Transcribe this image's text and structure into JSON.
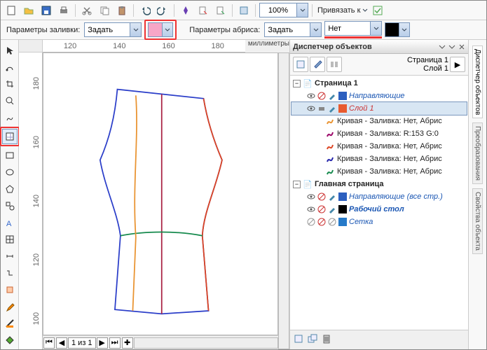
{
  "toolbar_top": {
    "zoom_value": "100%",
    "bind_label": "Привязать к",
    "icons": [
      "new",
      "open",
      "save",
      "print",
      "cut",
      "copy",
      "paste",
      "undo",
      "redo",
      "link",
      "pointer",
      "img1",
      "img2",
      "img3"
    ]
  },
  "prop_bar": {
    "fill_label": "Параметры заливки:",
    "fill_mode": "Задать",
    "fill_color": "#f7a6c7",
    "outline_label": "Параметры абриса:",
    "outline_mode": "Задать",
    "outline_value": "Нет",
    "outline_color": "#000000"
  },
  "ruler": {
    "h_marks": [
      "120",
      "140",
      "160",
      "180"
    ],
    "v_marks": [
      "180",
      "160",
      "140",
      "120",
      "100"
    ],
    "unit": "миллиметры"
  },
  "page_nav": {
    "label": "1 из 1"
  },
  "object_manager": {
    "title": "Диспетчер объектов",
    "page_current": "Страница 1",
    "layer_current": "Слой 1",
    "tree": [
      {
        "type": "page",
        "label": "Страница 1"
      },
      {
        "type": "guides",
        "label": "Направляющие"
      },
      {
        "type": "layer",
        "label": "Слой 1"
      },
      {
        "type": "curve",
        "label": "Кривая - Заливка: Нет, Абрис",
        "color": "#e99330"
      },
      {
        "type": "curve",
        "label": "Кривая - Заливка: R:153 G:0",
        "color": "#990066"
      },
      {
        "type": "curve",
        "label": "Кривая - Заливка: Нет, Абрис",
        "color": "#d42"
      },
      {
        "type": "curve",
        "label": "Кривая - Заливка: Нет, Абрис",
        "color": "#22a"
      },
      {
        "type": "curve",
        "label": "Кривая - Заливка: Нет, Абрис",
        "color": "#168"
      },
      {
        "type": "page",
        "label": "Главная страница"
      },
      {
        "type": "guides",
        "label": "Направляющие (все стр.)"
      },
      {
        "type": "desktop",
        "label": "Рабочий стол"
      },
      {
        "type": "grid",
        "label": "Сетка"
      }
    ]
  },
  "docked_tabs": [
    "Диспетчер объектов",
    "Преобразования",
    "Свойства объекта"
  ]
}
